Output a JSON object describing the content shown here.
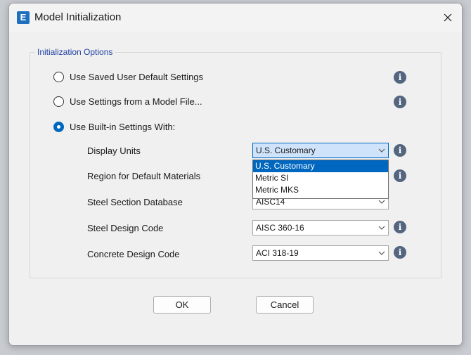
{
  "window": {
    "title": "Model Initialization",
    "app_icon_letter": "E"
  },
  "group": {
    "legend": "Initialization Options"
  },
  "radios": [
    {
      "label": "Use Saved User Default Settings",
      "checked": false
    },
    {
      "label": "Use Settings from a Model File...",
      "checked": false
    },
    {
      "label": "Use Built-in Settings With:",
      "checked": true
    }
  ],
  "fields": [
    {
      "label": "Display Units",
      "value": "U.S. Customary"
    },
    {
      "label": "Region for Default Materials",
      "value": ""
    },
    {
      "label": "Steel Section Database",
      "value": "AISC14"
    },
    {
      "label": "Steel Design Code",
      "value": "AISC 360-16"
    },
    {
      "label": "Concrete Design Code",
      "value": "ACI 318-19"
    }
  ],
  "dropdown": {
    "options": [
      "U.S. Customary",
      "Metric SI",
      "Metric MKS"
    ],
    "selected": "U.S. Customary"
  },
  "info_glyph": "i",
  "buttons": {
    "ok": "OK",
    "cancel": "Cancel"
  },
  "colors": {
    "accent": "#0067c0",
    "legend": "#1f3fa0",
    "info": "#53657f"
  }
}
